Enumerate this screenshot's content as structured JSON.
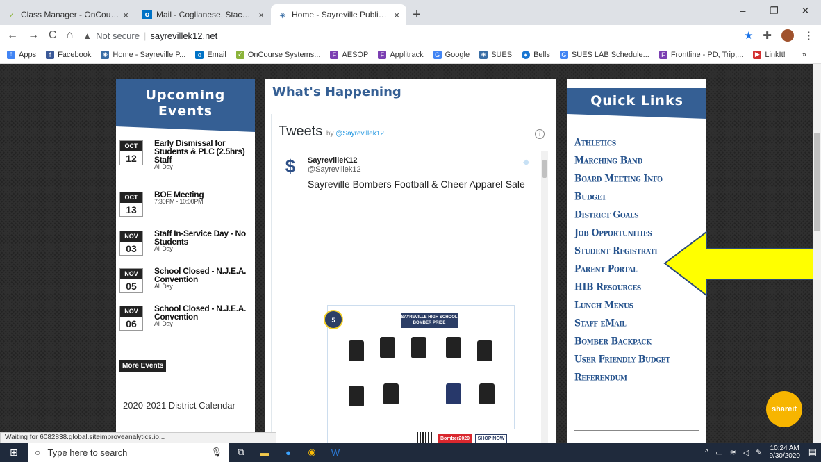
{
  "browser": {
    "tabs": [
      {
        "title": "Class Manager - OnCourse Syste",
        "icon": "oncourse-icon"
      },
      {
        "title": "Mail - Coglianese, Stacey - Outlo",
        "icon": "outlook-icon"
      },
      {
        "title": "Home - Sayreville Public Schools",
        "icon": "sayreville-icon"
      }
    ],
    "new_tab": "+",
    "tab_close": "×",
    "minimize": "–",
    "maximize": "❐",
    "close": "✕",
    "back": "←",
    "forward": "→",
    "reload": "C",
    "home": "⌂",
    "security": "▲",
    "not_secure": "Not secure",
    "url": "sayrevillek12.net",
    "bookmarks": [
      {
        "label": "Apps",
        "icon": "apps-icon",
        "color": "#4285f4"
      },
      {
        "label": "Facebook",
        "icon": "facebook-icon",
        "color": "#3b5998"
      },
      {
        "label": "Home - Sayreville P...",
        "icon": "sayreville-icon",
        "color": "#3a6ea5"
      },
      {
        "label": "Email",
        "icon": "outlook-icon",
        "color": "#0072c6"
      },
      {
        "label": "OnCourse Systems...",
        "icon": "oncourse-icon",
        "color": "#8bb33a"
      },
      {
        "label": "AESOP",
        "icon": "frontline-icon",
        "color": "#7b3fb2"
      },
      {
        "label": "Applitrack",
        "icon": "frontline-icon",
        "color": "#7b3fb2"
      },
      {
        "label": "Google",
        "icon": "google-icon",
        "color": "#4285f4"
      },
      {
        "label": "SUES",
        "icon": "sayreville-icon",
        "color": "#3a6ea5"
      },
      {
        "label": "Bells",
        "icon": "globe-icon",
        "color": "#1976d2"
      },
      {
        "label": "SUES LAB Schedule...",
        "icon": "google-icon",
        "color": "#4285f4"
      },
      {
        "label": "Frontline - PD, Trip,...",
        "icon": "frontline-icon",
        "color": "#7b3fb2"
      },
      {
        "label": "LinkIt!",
        "icon": "linkit-icon",
        "color": "#d32f2f"
      }
    ],
    "more_bookmarks": "»"
  },
  "events": {
    "header": "Upcoming Events",
    "items": [
      {
        "month": "OCT",
        "day": "12",
        "title": "Early Dismissal for Students & PLC (2.5hrs) Staff",
        "time": "All Day"
      },
      {
        "month": "OCT",
        "day": "13",
        "title": "BOE Meeting",
        "time": "7:30PM - 10:00PM"
      },
      {
        "month": "NOV",
        "day": "03",
        "title": "Staff In-Service Day - No Students",
        "time": "All Day"
      },
      {
        "month": "NOV",
        "day": "05",
        "title": "School Closed - N.J.E.A. Convention",
        "time": "All Day"
      },
      {
        "month": "NOV",
        "day": "06",
        "title": "School Closed - N.J.E.A. Convention",
        "time": "All Day"
      }
    ],
    "more": "More Events",
    "calendar_title": "2020-2021 District Calendar"
  },
  "happening": {
    "title": "What's Happening",
    "tweets_label": "Tweets",
    "by": "by",
    "by_handle": "@Sayrevillek12",
    "info": "i",
    "tweet": {
      "name": "SayrevilleK12",
      "handle": "@Sayrevillek12",
      "text": "Sayreville Bombers Football & Cheer Apparel Sale"
    },
    "flyer": {
      "title": "SAYREVILLE HIGH SCHOOL BOMBER PRIDE",
      "badge": "5",
      "code": "Bomber2020",
      "shop": "SHOP NOW"
    }
  },
  "quick_links": {
    "header": "Quick Links",
    "items": [
      "Athletics",
      "Marching Band",
      "Board Meeting Info",
      "Budget",
      "District Goals",
      "Job Opportunities",
      "Student Registrati",
      "Parent Portal",
      "HIB Resources",
      "Lunch Menus",
      "Staff eMail",
      "Bomber Backpack",
      "User Friendly Budget",
      "Referendum"
    ]
  },
  "shareit": "shareit",
  "status_text": "Waiting for 6082838.global.siteimproveanalytics.io...",
  "taskbar": {
    "search_placeholder": "Type here to search",
    "time": "10:24 AM",
    "date": "9/30/2020"
  },
  "colors": {
    "brand_blue": "#355f94",
    "link_blue": "#26538d",
    "arrow_yellow": "#ffff00"
  }
}
